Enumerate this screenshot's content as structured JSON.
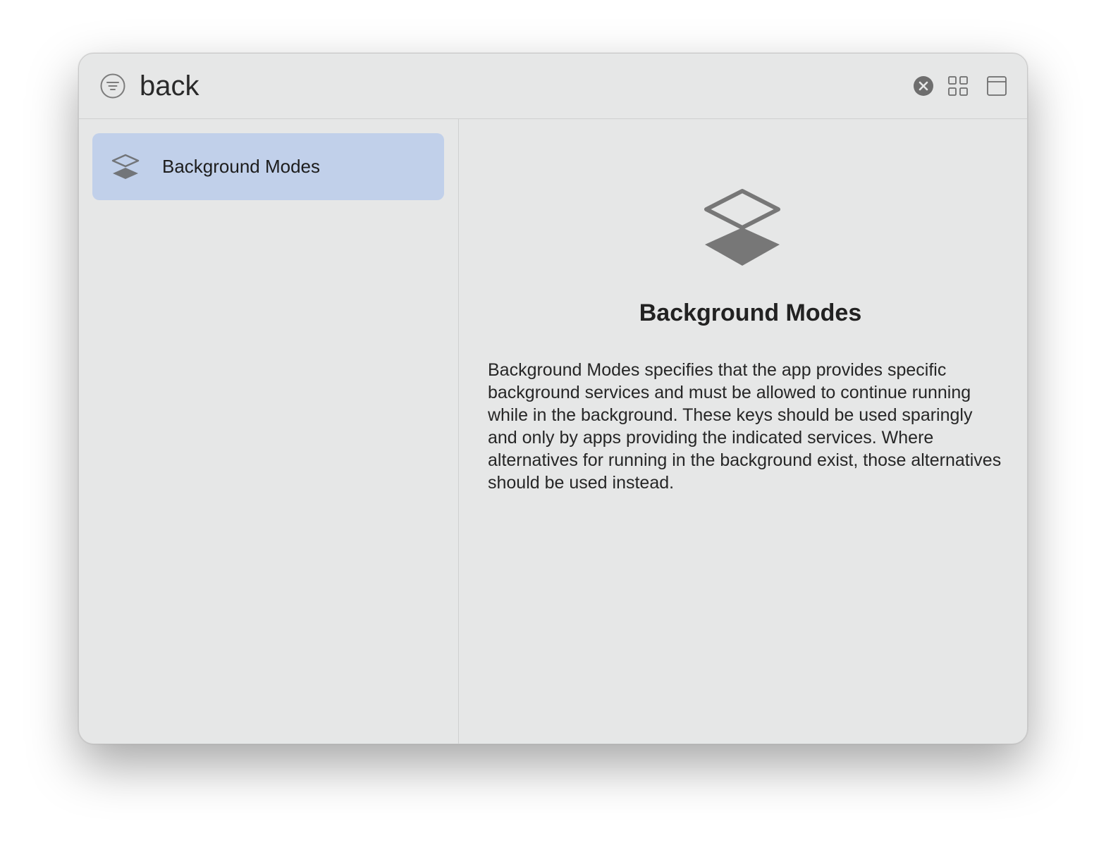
{
  "search": {
    "value": "back",
    "placeholder": ""
  },
  "toolbar": {
    "filter_icon": "filter-circle-icon",
    "clear_icon": "xmark-circle-fill-icon",
    "grid_icon": "square-grid-icon",
    "panel_icon": "window-panel-icon"
  },
  "list": {
    "items": [
      {
        "label": "Background Modes",
        "icon": "stacked-layers-icon",
        "selected": true
      }
    ]
  },
  "detail": {
    "icon": "stacked-layers-icon",
    "title": "Background Modes",
    "description": "Background Modes specifies that the app provides specific background services and must be allowed to continue running while in the background. These keys should be used sparingly and only by apps providing the indicated services. Where alternatives for running in the background exist, those alternatives should be used instead."
  },
  "colors": {
    "window_bg": "#e6e7e7",
    "selection_bg": "#c1d0ea",
    "icon_gray": "#7a7a7a"
  }
}
